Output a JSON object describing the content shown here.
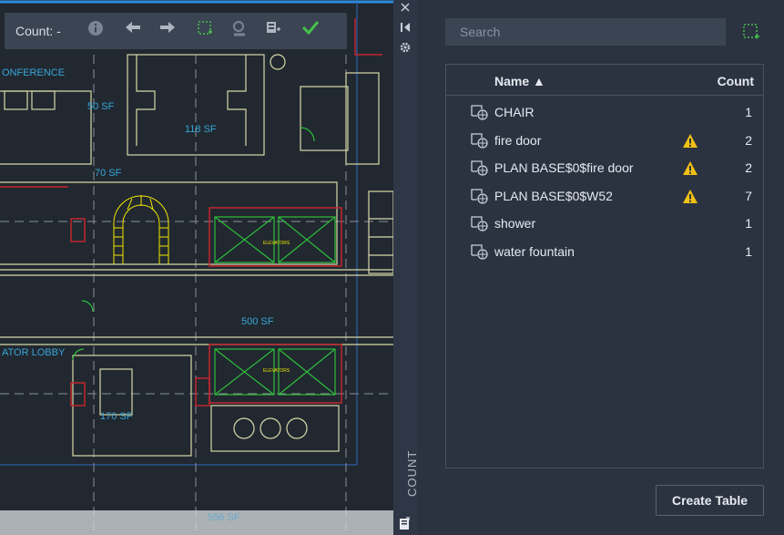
{
  "toolbar": {
    "count_label": "Count: -",
    "icons": [
      "info-icon",
      "previous-arrow-icon",
      "next-arrow-icon",
      "select-object-icon",
      "find-icon",
      "insert-field-icon",
      "check-icon"
    ]
  },
  "canvas": {
    "labels": {
      "conference": "ONFERENCE",
      "sf50": "50 SF",
      "sf118": "118 SF",
      "sf70": "70 SF",
      "sf500": "500 SF",
      "elevator_lobby": "ATOR LOBBY",
      "sf170": "170 SF",
      "elevators1": "ELEVATORS",
      "elevators2": "ELEVATORS",
      "sf556": "556 SF"
    }
  },
  "strip": {
    "title": "COUNT",
    "icons": [
      "close-icon",
      "collapse-icon",
      "settings-icon",
      "count-table-icon"
    ]
  },
  "panel": {
    "search_placeholder": "Search",
    "header": {
      "name": "Name ▲",
      "count": "Count"
    },
    "rows": [
      {
        "name": "CHAIR",
        "count": "1",
        "warning": false
      },
      {
        "name": "fire door",
        "count": "2",
        "warning": true
      },
      {
        "name": "PLAN BASE$0$fire door",
        "count": "2",
        "warning": true
      },
      {
        "name": "PLAN BASE$0$W52",
        "count": "7",
        "warning": true
      },
      {
        "name": "shower",
        "count": "1",
        "warning": false
      },
      {
        "name": "water fountain",
        "count": "1",
        "warning": false
      }
    ],
    "create_table_label": "Create Table"
  },
  "colors": {
    "accent_green": "#45c04a",
    "warning_yellow": "#f2c114",
    "wall_yellow": "#d8d8a8",
    "wall_red": "#c2262d",
    "label_cyan": "#38a6d8"
  }
}
